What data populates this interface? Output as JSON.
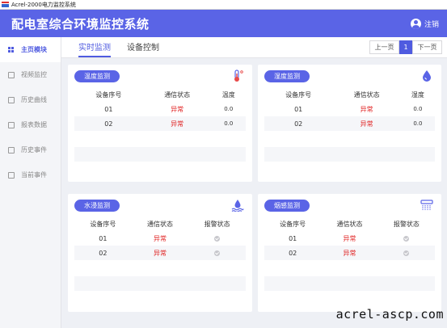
{
  "window": {
    "title": "Acrel-2000电力监控系统"
  },
  "header": {
    "title": "配电室综合环境监控系统",
    "logout_label": "注销"
  },
  "sidebar": {
    "items": [
      {
        "label": "主页模块",
        "icon": "grid-icon"
      },
      {
        "label": "视频监控",
        "icon": "video-icon"
      },
      {
        "label": "历史曲线",
        "icon": "chart-icon"
      },
      {
        "label": "报表数据",
        "icon": "report-icon"
      },
      {
        "label": "历史事件",
        "icon": "history-icon"
      },
      {
        "label": "当前事件",
        "icon": "event-icon"
      }
    ]
  },
  "tabs": [
    {
      "label": "实时监测"
    },
    {
      "label": "设备控制"
    }
  ],
  "pager": {
    "prev": "上一页",
    "current": "1",
    "next": "下一页"
  },
  "cards": [
    {
      "title": "温度监测",
      "icon": "thermometer-icon",
      "headers": [
        "设备序号",
        "通信状态",
        "温度"
      ],
      "rows": [
        [
          "01",
          "异常",
          "0.0"
        ],
        [
          "02",
          "异常",
          "0.0"
        ]
      ]
    },
    {
      "title": "湿度监测",
      "icon": "droplet-icon",
      "headers": [
        "设备序号",
        "通信状态",
        "湿度"
      ],
      "rows": [
        [
          "01",
          "异常",
          "0.0"
        ],
        [
          "02",
          "异常",
          "0.0"
        ]
      ]
    },
    {
      "title": "水浸监测",
      "icon": "water-leak-icon",
      "headers": [
        "设备序号",
        "通信状态",
        "报警状态"
      ],
      "rows": [
        [
          "01",
          "异常",
          ""
        ],
        [
          "02",
          "异常",
          ""
        ]
      ]
    },
    {
      "title": "烟感监测",
      "icon": "smoke-detector-icon",
      "headers": [
        "设备序号",
        "通信状态",
        "报警状态"
      ],
      "rows": [
        [
          "01",
          "异常",
          ""
        ],
        [
          "02",
          "异常",
          ""
        ]
      ]
    }
  ],
  "colors": {
    "accent": "#5a64e6",
    "alert": "#e02020"
  },
  "watermark": "acrel-ascp.com"
}
